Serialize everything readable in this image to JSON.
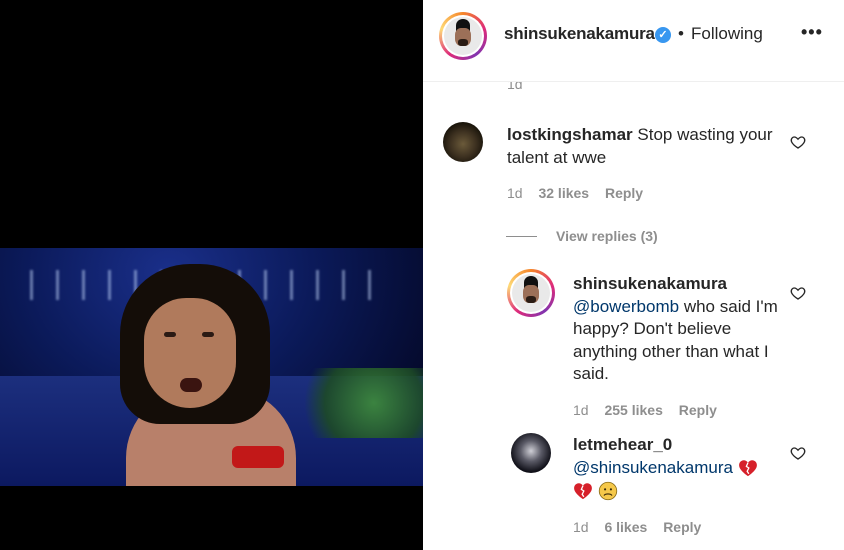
{
  "post": {
    "author": "shinsukenakamura",
    "follow_status": "Following",
    "separator": "•",
    "more_icon": "more-horizontal-icon",
    "more_label": "•••"
  },
  "partial_timestamp": "1d",
  "comments": [
    {
      "username": "lostkingshamar",
      "text": "Stop wasting your talent at wwe",
      "time": "1d",
      "likes": "32 likes",
      "reply": "Reply"
    }
  ],
  "view_replies": "View replies (3)",
  "replies": [
    {
      "username": "shinsukenakamura",
      "mention": "@bowerbomb",
      "text": "who said I'm happy? Don't believe anything other than what I said.",
      "time": "1d",
      "likes": "255 likes",
      "reply": "Reply"
    },
    {
      "username": "letmehear_0",
      "mention": "@shinsukenakamura",
      "emoji": [
        "broken-heart",
        "broken-heart",
        "frowning-face"
      ],
      "time": "1d",
      "likes": "6 likes",
      "reply": "Reply"
    }
  ],
  "colors": {
    "verified": "#3897f0",
    "mention": "#00376b",
    "meta": "#8e8e8e",
    "text": "#262626",
    "broken_heart": "#d6202a"
  }
}
